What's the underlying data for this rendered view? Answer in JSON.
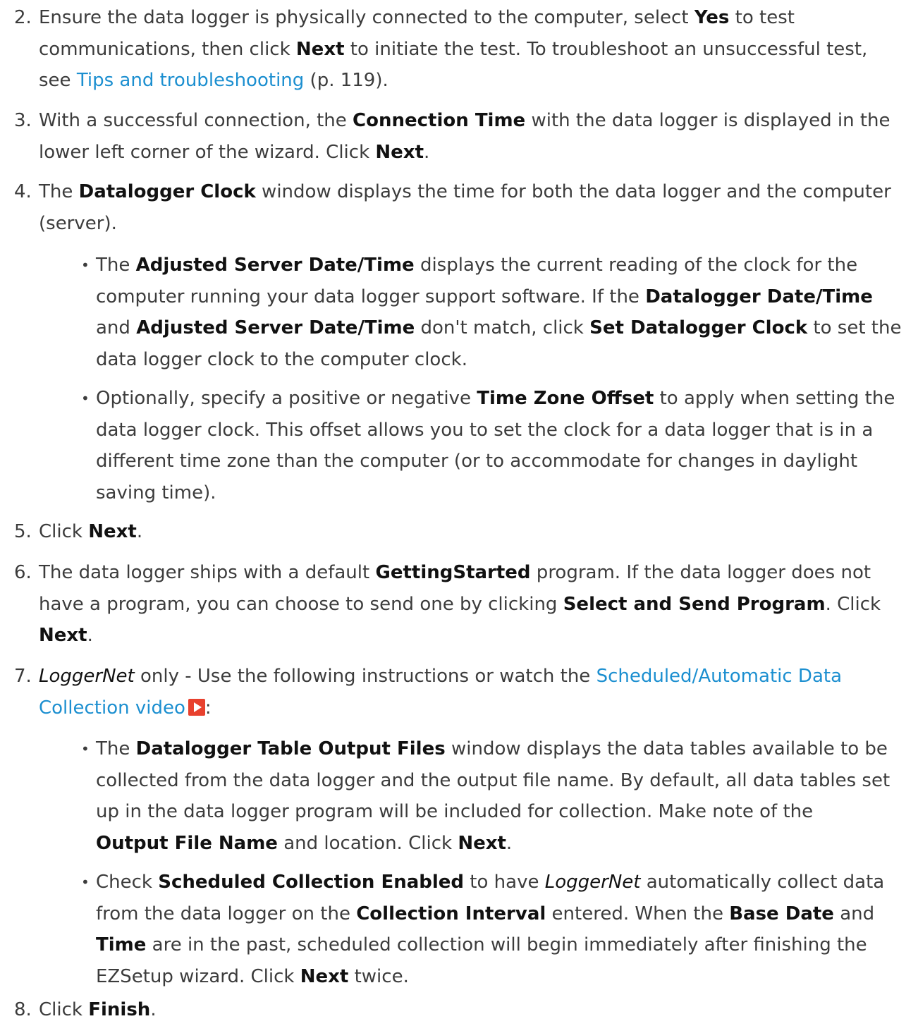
{
  "steps": [
    {
      "num": "2.",
      "a": "Ensure the data logger is physically connected to the computer, select ",
      "b": "Yes",
      "c": " to test",
      "d": "communications, then click ",
      "e": "Next",
      "f": " to initiate the test. To troubleshoot an unsuccessful test,",
      "g": "see ",
      "link": "Tips and troubleshooting",
      "h": " (p. 119)."
    },
    {
      "num": "3.",
      "a": "With a successful connection, the ",
      "b": "Connection Time",
      "c": " with the data logger is displayed in the",
      "d": "lower left corner of the wizard. Click ",
      "e": "Next",
      "f": "."
    },
    {
      "num": "4.",
      "a": " The ",
      "b": "Datalogger Clock",
      "c": " window displays the time for both the data logger and the computer",
      "d": "(server)."
    },
    {
      "num": "5.",
      "a": "Click ",
      "b": "Next",
      "c": "."
    },
    {
      "num": "6.",
      "a": "The data logger ships with a default ",
      "b": "GettingStarted",
      "c": " program. If the data logger does not",
      "d": "have a program, you can choose to send one by clicking ",
      "e": "Select and Send Program",
      "f": ". Click",
      "g": "Next",
      "h": "."
    },
    {
      "num": "7.",
      "a": "LoggerNet",
      "b": " only - Use the following instructions or watch the ",
      "link1": "Scheduled/Automatic Data",
      "link2": "Collection video",
      "c": ":"
    },
    {
      "num": "8.",
      "a": "Click ",
      "b": "Finish",
      "c": "."
    }
  ],
  "bullets": {
    "b1": {
      "l1a": "The ",
      "l1b": "Adjusted Server Date/Time",
      "l1c": " displays the current reading of the clock for the",
      "l2a": "computer running your data logger support software. If the ",
      "l2b": "Datalogger Date/Time",
      "l3a": "and ",
      "l3b": "Adjusted Server Date/Time",
      "l3c": " don't match, click ",
      "l3d": "Set Datalogger Clock",
      "l3e": " to set the",
      "l4": "data logger clock to the computer clock."
    },
    "b2": {
      "l1a": "Optionally, specify a positive or negative ",
      "l1b": "Time Zone Offset",
      "l1c": " to apply when setting the",
      "l2": "data logger clock. This offset allows you to set the clock for a data logger that is in a",
      "l3": "different time zone than the computer (or to accommodate for changes in daylight",
      "l4": "saving time)."
    },
    "b3": {
      "l1a": "The ",
      "l1b": "Datalogger Table Output Files",
      "l1c": " window displays the data tables available to be",
      "l2": "collected from the data logger and the output file name. By default, all data tables set",
      "l3": "up in the data logger program will be included for collection. Make note of the",
      "l4a": "Output File Name",
      "l4b": " and location. Click ",
      "l4c": "Next",
      "l4d": "."
    },
    "b4": {
      "l1a": "Check ",
      "l1b": "Scheduled Collection Enabled",
      "l1c": " to have ",
      "l1d": "LoggerNet",
      "l1e": " automatically collect data",
      "l2a": "from the data logger on the ",
      "l2b": "Collection Interval",
      "l2c": " entered. When the ",
      "l2d": "Base Date",
      "l2e": " and",
      "l3a": "Time",
      "l3b": " are in the past, scheduled collection will begin immediately after finishing the",
      "l4a": "EZSetup wizard. Click ",
      "l4b": "Next",
      "l4c": " twice."
    },
    "dot": "•"
  },
  "icons": {
    "play": "video-play-icon",
    "play_color": "#e8412e",
    "link_color": "#1c8fd0"
  }
}
